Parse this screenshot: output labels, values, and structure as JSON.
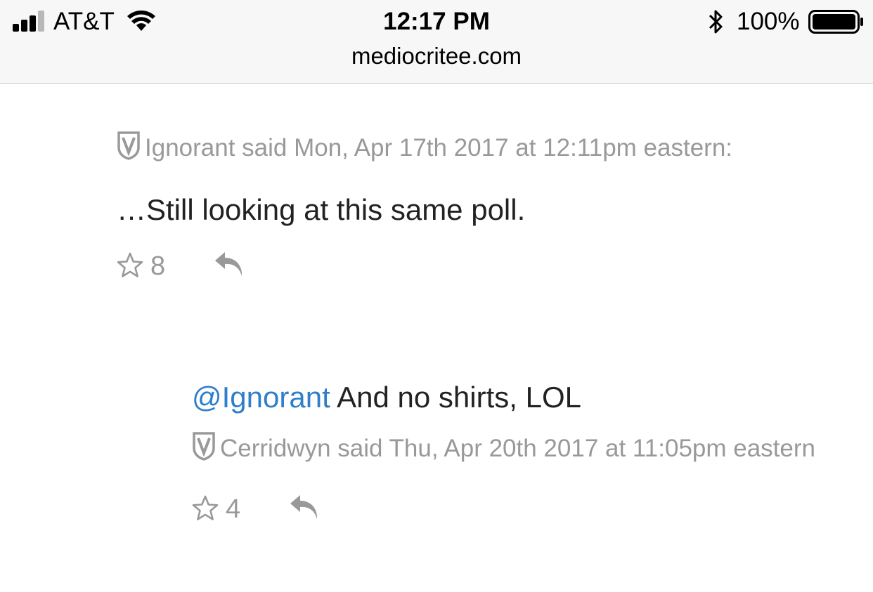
{
  "status_bar": {
    "carrier": "AT&T",
    "time": "12:17 PM",
    "battery_percent": "100%",
    "battery_level": 1.0,
    "url": "mediocritee.com"
  },
  "comments": [
    {
      "meta": "Ignorant said Mon, Apr 17th 2017 at 12:11pm eastern:",
      "body": "…Still looking at this same poll.",
      "stars": "8",
      "icons": [
        "shield-v-icon",
        "star-icon",
        "reply-icon"
      ]
    },
    {
      "mention": "@Ignorant",
      "body": " And no shirts, LOL",
      "meta": "Cerridwyn said Thu, Apr 20th 2017 at 11:05pm eastern",
      "stars": "4",
      "icons": [
        "shield-v-icon",
        "star-icon",
        "reply-icon"
      ]
    }
  ],
  "colors": {
    "meta_gray": "#999999",
    "mention_blue": "#2f7ec9",
    "body_text": "#222222"
  }
}
